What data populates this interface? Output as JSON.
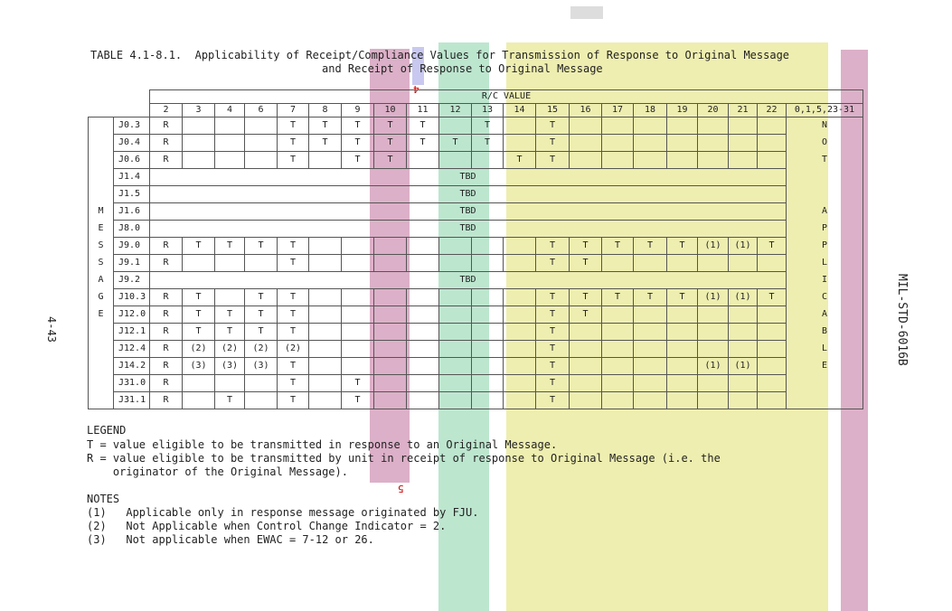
{
  "title_line1": "TABLE 4.1-8.1.  Applicability of Receipt/Compliance Values for Transmission of Response to Original Message",
  "title_line2": "and Receipt of Response to Original Message",
  "rc_header": "R/C VALUE",
  "columns": [
    "2",
    "3",
    "4",
    "6",
    "7",
    "8",
    "9",
    "10",
    "11",
    "12",
    "13",
    "14",
    "15",
    "16",
    "17",
    "18",
    "19",
    "20",
    "21",
    "22",
    "0,1,5,23-31"
  ],
  "message_label": [
    "M",
    "E",
    "S",
    "S",
    "A",
    "G",
    "E"
  ],
  "not_applicable": [
    "N",
    "O",
    "T",
    "",
    "",
    "A",
    "P",
    "P",
    "L",
    "I",
    "C",
    "A",
    "B",
    "L",
    "E"
  ],
  "rows": [
    {
      "id": "J0.3",
      "cells": [
        "R",
        "",
        "",
        "",
        "T",
        "T",
        "T",
        "T",
        "T",
        "",
        "T",
        "",
        "T",
        "",
        "",
        "",
        "",
        "",
        "",
        "",
        ""
      ]
    },
    {
      "id": "J0.4",
      "cells": [
        "R",
        "",
        "",
        "",
        "T",
        "T",
        "T",
        "T",
        "T",
        "T",
        "T",
        "",
        "T",
        "",
        "",
        "",
        "",
        "",
        "",
        "",
        ""
      ]
    },
    {
      "id": "J0.6",
      "cells": [
        "R",
        "",
        "",
        "",
        "T",
        "",
        "T",
        "T",
        "",
        "",
        "",
        "T",
        "T",
        "",
        "",
        "",
        "",
        "",
        "",
        "",
        ""
      ]
    },
    {
      "id": "J1.4",
      "tbd": "TBD"
    },
    {
      "id": "J1.5",
      "tbd": "TBD"
    },
    {
      "id": "J1.6",
      "tbd": "TBD"
    },
    {
      "id": "J8.0",
      "tbd": "TBD"
    },
    {
      "id": "J9.0",
      "cells": [
        "R",
        "T",
        "T",
        "T",
        "T",
        "",
        "",
        "",
        "",
        "",
        "",
        "",
        "T",
        "T",
        "T",
        "T",
        "T",
        "(1)",
        "(1)",
        "T",
        ""
      ]
    },
    {
      "id": "J9.1",
      "cells": [
        "R",
        "",
        "",
        "",
        "T",
        "",
        "",
        "",
        "",
        "",
        "",
        "",
        "T",
        "T",
        "",
        "",
        "",
        "",
        "",
        "",
        ""
      ]
    },
    {
      "id": "J9.2",
      "tbd": "TBD"
    },
    {
      "id": "J10.3",
      "cells": [
        "R",
        "T",
        "",
        "T",
        "T",
        "",
        "",
        "",
        "",
        "",
        "",
        "",
        "T",
        "T",
        "T",
        "T",
        "T",
        "(1)",
        "(1)",
        "T",
        ""
      ]
    },
    {
      "id": "J12.0",
      "cells": [
        "R",
        "T",
        "T",
        "T",
        "T",
        "",
        "",
        "",
        "",
        "",
        "",
        "",
        "T",
        "T",
        "",
        "",
        "",
        "",
        "",
        "",
        ""
      ]
    },
    {
      "id": "J12.1",
      "cells": [
        "R",
        "T",
        "T",
        "T",
        "T",
        "",
        "",
        "",
        "",
        "",
        "",
        "",
        "T",
        "",
        "",
        "",
        "",
        "",
        "",
        "",
        ""
      ]
    },
    {
      "id": "J12.4",
      "cells": [
        "R",
        "(2)",
        "(2)",
        "(2)",
        "(2)",
        "",
        "",
        "",
        "",
        "",
        "",
        "",
        "T",
        "",
        "",
        "",
        "",
        "",
        "",
        "",
        ""
      ]
    },
    {
      "id": "J14.2",
      "cells": [
        "R",
        "(3)",
        "(3)",
        "(3)",
        "T",
        "",
        "",
        "",
        "",
        "",
        "",
        "",
        "T",
        "",
        "",
        "",
        "",
        "(1)",
        "(1)",
        "",
        ""
      ]
    },
    {
      "id": "J31.0",
      "cells": [
        "R",
        "",
        "",
        "",
        "T",
        "",
        "T",
        "",
        "",
        "",
        "",
        "",
        "T",
        "",
        "",
        "",
        "",
        "",
        "",
        "",
        ""
      ]
    },
    {
      "id": "J31.1",
      "cells": [
        "R",
        "",
        "T",
        "",
        "T",
        "",
        "T",
        "",
        "",
        "",
        "",
        "",
        "T",
        "",
        "",
        "",
        "",
        "",
        "",
        "",
        ""
      ]
    }
  ],
  "legend": {
    "heading": "LEGEND",
    "line1": "T = value eligible to be transmitted in response to an Original Message.",
    "line2": "R = value eligible to be transmitted by unit in receipt of response to Original Message (i.e. the",
    "line3": "    originator of the Original Message)."
  },
  "notes": {
    "heading": "NOTES",
    "n1": "(1)   Applicable only in response message originated by FJU.",
    "n2": "(2)   Not Applicable when Control Change Indicator = 2.",
    "n3": "(3)   Not applicable when EWAC = 7-12 or 26."
  },
  "page_number": "4-43",
  "doc_id": "MIL-STD-6016B",
  "marker_4": "4",
  "marker_5": "5",
  "colors": {
    "pink": "#dcb0c8",
    "blue": "#c8c8f0",
    "green": "#bde6cf",
    "yellow": "#eeeeb0",
    "gray": "#dddddd"
  }
}
